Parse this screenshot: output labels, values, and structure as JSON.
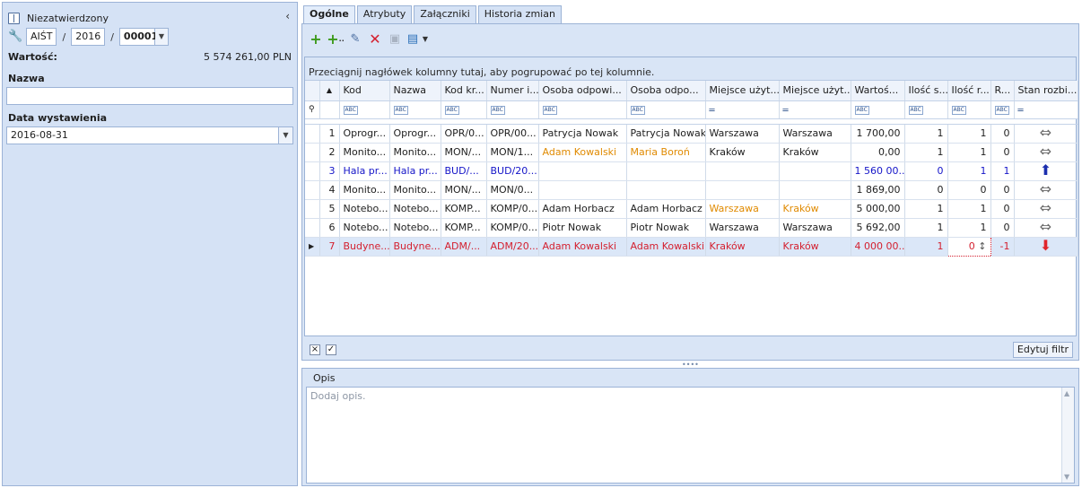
{
  "header": {
    "status": "Niezatwierdzony",
    "collapse": "‹",
    "doc_prefix": "AIŚT",
    "doc_year": "2016",
    "doc_number": "00001",
    "sep": "/"
  },
  "summary": {
    "value_label": "Wartość:",
    "value": "5 574 261,00 PLN",
    "name_label": "Nazwa",
    "name_value": "",
    "date_label": "Data wystawienia",
    "date_value": "2016-08-31"
  },
  "tabs": [
    "Ogólne",
    "Atrybuty",
    "Załączniki",
    "Historia zmian"
  ],
  "toolbar": {
    "icons": [
      "add-icon",
      "add-multiple-icon",
      "edit-icon",
      "delete-icon",
      "disabled-icon",
      "export-icon"
    ]
  },
  "grid": {
    "group_hint": "Przeciągnij nagłówek kolumny tutaj, aby pogrupować po tej kolumnie.",
    "columns": [
      "",
      "Kod",
      "Nazwa",
      "Kod kr...",
      "Numer i...",
      "Osoba odpowi...",
      "Osoba odpo...",
      "Miejsce użyt...",
      "Miejsce użyt...",
      "Wartoś...",
      "Ilość s...",
      "Ilość r...",
      "R...",
      "Stan rozbi..."
    ],
    "filter_types": [
      "abc",
      "abc",
      "abc",
      "abc",
      "abc",
      "abc",
      "=",
      "=",
      "abc",
      "abc",
      "abc",
      "abc",
      "="
    ],
    "rows": [
      [
        "1",
        "Oprogr...",
        "Oprogr...",
        "OPR/0...",
        "OPR/00...",
        "Patrycja Nowak",
        "Patrycja Nowak",
        "Warszawa",
        "Warszawa",
        "1 700,00",
        "1",
        "1",
        "0",
        "both"
      ],
      [
        "2",
        "Monito...",
        "Monito...",
        "MON/...",
        "MON/1...",
        "Adam Kowalski",
        "Maria Boroń",
        "Kraków",
        "Kraków",
        "0,00",
        "1",
        "1",
        "0",
        "both"
      ],
      [
        "3",
        "Hala pr...",
        "Hala pr...",
        "BUD/...",
        "BUD/20...",
        "",
        "",
        "",
        "",
        "1 560 00...",
        "0",
        "1",
        "1",
        "up"
      ],
      [
        "4",
        "Monito...",
        "Monito...",
        "MON/...",
        "MON/0...",
        "",
        "",
        "",
        "",
        "1 869,00",
        "0",
        "0",
        "0",
        "both"
      ],
      [
        "5",
        "Notebo...",
        "Notebo...",
        "KOMP...",
        "KOMP/0...",
        "Adam Horbacz",
        "Adam Horbacz",
        "Warszawa",
        "Kraków",
        "5 000,00",
        "1",
        "1",
        "0",
        "both"
      ],
      [
        "6",
        "Notebo...",
        "Notebo...",
        "KOMP...",
        "KOMP/0...",
        "Piotr Nowak",
        "Piotr Nowak",
        "Warszawa",
        "Warszawa",
        "5 692,00",
        "1",
        "1",
        "0",
        "both"
      ],
      [
        "7",
        "Budyne...",
        "Budyne...",
        "ADM/...",
        "ADM/20...",
        "Adam Kowalski",
        "Adam Kowalski",
        "Kraków",
        "Kraków",
        "4 000 00...",
        "1",
        "0",
        "-1",
        "down"
      ]
    ],
    "edit_filter": "Edytuj filtr"
  },
  "description": {
    "label": "Opis",
    "placeholder": "Dodaj opis."
  },
  "colors": {
    "panel_bg": "#d5e2f5",
    "border": "#9cb3d6",
    "blue_row": "#1515c8",
    "red_row": "#d4202f",
    "orange": "#e08a00",
    "green_add": "#3c9a1b"
  }
}
